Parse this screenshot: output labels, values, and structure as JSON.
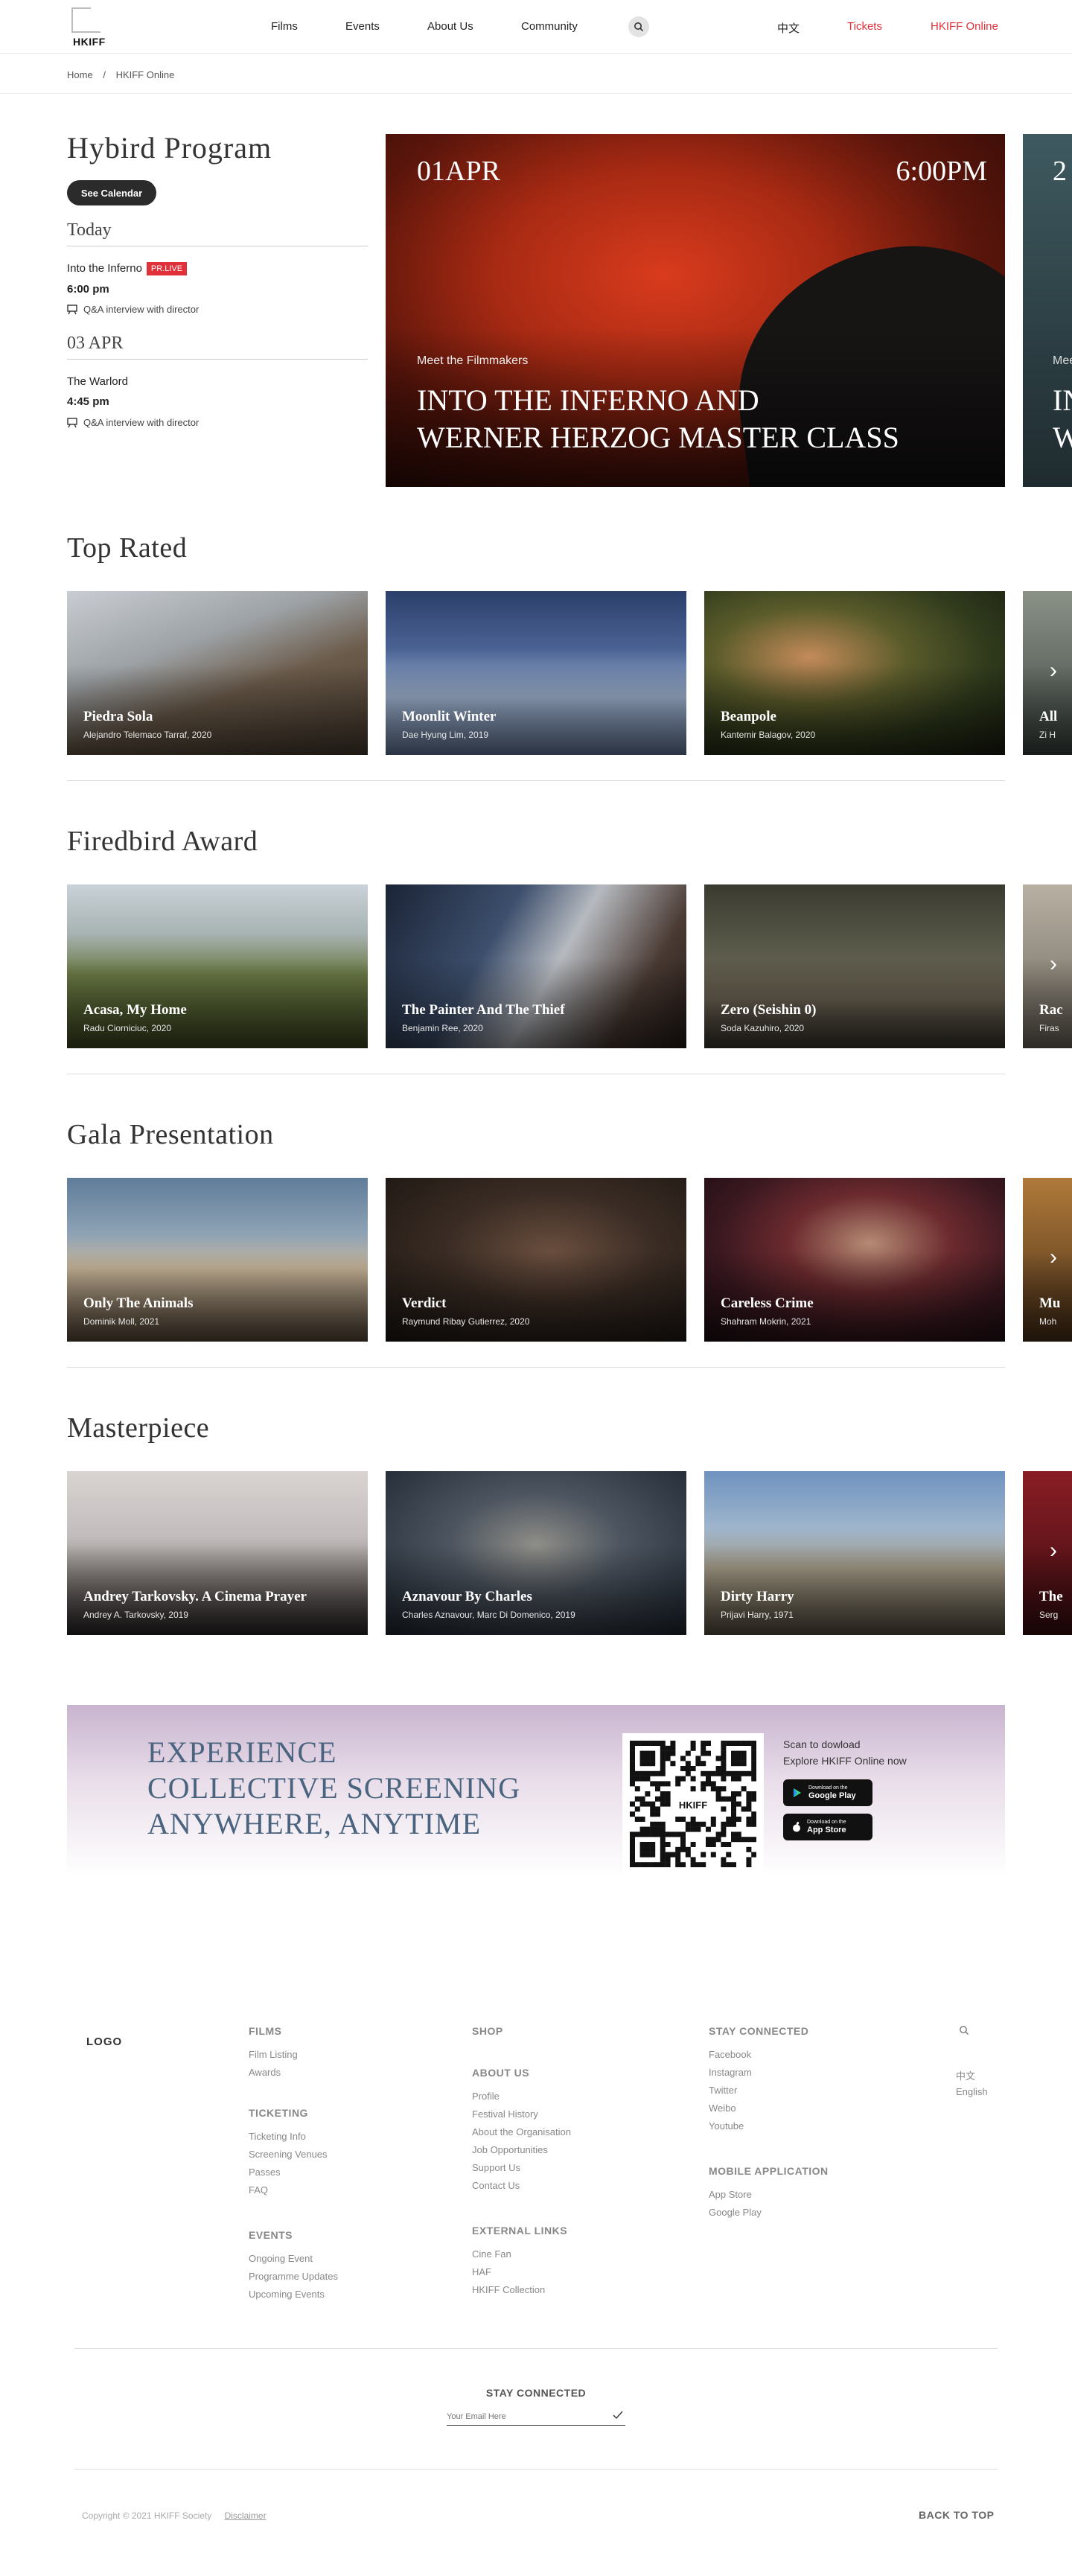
{
  "header": {
    "logo_text": "HKIFF",
    "nav": [
      "Films",
      "Events",
      "About Us",
      "Community"
    ],
    "lang": "中文",
    "tickets": "Tickets",
    "online": "HKIFF Online",
    "accent_color": "#e0313b"
  },
  "breadcrumb": [
    "Home",
    "/",
    "HKIFF Online"
  ],
  "hybrid": {
    "title": "Hybird  Program",
    "calendar_button": "See Calendar",
    "days": [
      {
        "heading": "Today",
        "film": "Into the Inferno",
        "badge": "PR.LIVE",
        "time": "6:00 pm",
        "note": "Q&A interview with director"
      },
      {
        "heading": "03 APR",
        "film": "The Warlord",
        "badge": "",
        "time": "4:45 pm",
        "note": "Q&A interview with director"
      }
    ],
    "hero": {
      "date": "01APR",
      "time": "6:00PM",
      "kicker": "Meet the Filmmakers",
      "title_line1": "INTO THE INFERNO AND",
      "title_line2": "WERNER HERZOG MASTER CLASS"
    },
    "hero_peek": {
      "date": "2",
      "kicker": "Mee",
      "title_line1": "IN",
      "title_line2": "W"
    }
  },
  "sections": [
    {
      "title": "Top Rated",
      "cards": [
        {
          "title": "Piedra Sola",
          "sub": "Alejandro Telemaco Tarraf, 2020"
        },
        {
          "title": "Moonlit Winter",
          "sub": "Dae Hyung Lim, 2019"
        },
        {
          "title": "Beanpole",
          "sub": "Kantemir Balagov, 2020"
        },
        {
          "title": "All",
          "sub": "Zi H"
        }
      ]
    },
    {
      "title": "Firedbird Award",
      "cards": [
        {
          "title": "Acasa, My Home",
          "sub": "Radu Ciorniciuc, 2020"
        },
        {
          "title": "The Painter And The Thief",
          "sub": "Benjamin Ree, 2020"
        },
        {
          "title": "Zero (Seishin 0)",
          "sub": "Soda Kazuhiro, 2020"
        },
        {
          "title": "Rac",
          "sub": "Firas"
        }
      ]
    },
    {
      "title": "Gala Presentation",
      "cards": [
        {
          "title": "Only The Animals",
          "sub": "Dominik Moll, 2021"
        },
        {
          "title": "Verdict",
          "sub": "Raymund Ribay Gutierrez, 2020"
        },
        {
          "title": "Careless Crime",
          "sub": "Shahram Mokrin, 2021"
        },
        {
          "title": "Mu",
          "sub": "Moh"
        }
      ]
    },
    {
      "title": "Masterpiece",
      "cards": [
        {
          "title": "Andrey Tarkovsky. A Cinema Prayer",
          "sub": "Andrey A. Tarkovsky, 2019"
        },
        {
          "title": "Aznavour By Charles",
          "sub": "Charles Aznavour, Marc Di Domenico, 2019"
        },
        {
          "title": "Dirty Harry",
          "sub": "Prijavi Harry, 1971"
        },
        {
          "title": "The",
          "sub": "Serg"
        }
      ]
    }
  ],
  "promo": {
    "line1": "EXPERIENCE",
    "line2": "COLLECTIVE SCREENING",
    "line3": "ANYWHERE, ANYTIME",
    "qr_label": "HKIFF",
    "scan1": "Scan to dowload",
    "scan2": "Explore HKIFF Online now",
    "google_small": "Download on the",
    "google_big": "Google Play",
    "apple_small": "Download on the",
    "apple_big": "App Store"
  },
  "footer": {
    "logo": "LOGO",
    "films_h": "FILMS",
    "films": [
      "Film Listing",
      "Awards"
    ],
    "ticketing_h": "TICKETING",
    "ticketing": [
      "Ticketing Info",
      "Screening Venues",
      "Passes",
      "FAQ"
    ],
    "events_h": "EVENTS",
    "events": [
      "Ongoing Event",
      "Programme Updates",
      "Upcoming Events"
    ],
    "shop_h": "SHOP",
    "about_h": "ABOUT US",
    "about": [
      "Profile",
      "Festival History",
      "About the Organisation",
      "Job Opportunities",
      "Support Us",
      "Contact Us"
    ],
    "external_h": "EXTERNAL LINKS",
    "external": [
      "Cine Fan",
      "HAF",
      "HKIFF Collection"
    ],
    "stay_h": "STAY CONNECTED",
    "stay": [
      "Facebook",
      "Instagram",
      "Twitter",
      "Weibo",
      "Youtube"
    ],
    "mobile_h": "MOBILE APPLICATION",
    "mobile": [
      "App Store",
      "Google Play"
    ],
    "lang": [
      "中文",
      "English"
    ],
    "newsletter_h": "STAY CONNECTED",
    "email_placeholder": "Your Email Here",
    "copyright": "Copyright © 2021 HKIFF Society",
    "disclaimer": "Disclaimer",
    "back_to_top": "BACK TO TOP"
  }
}
